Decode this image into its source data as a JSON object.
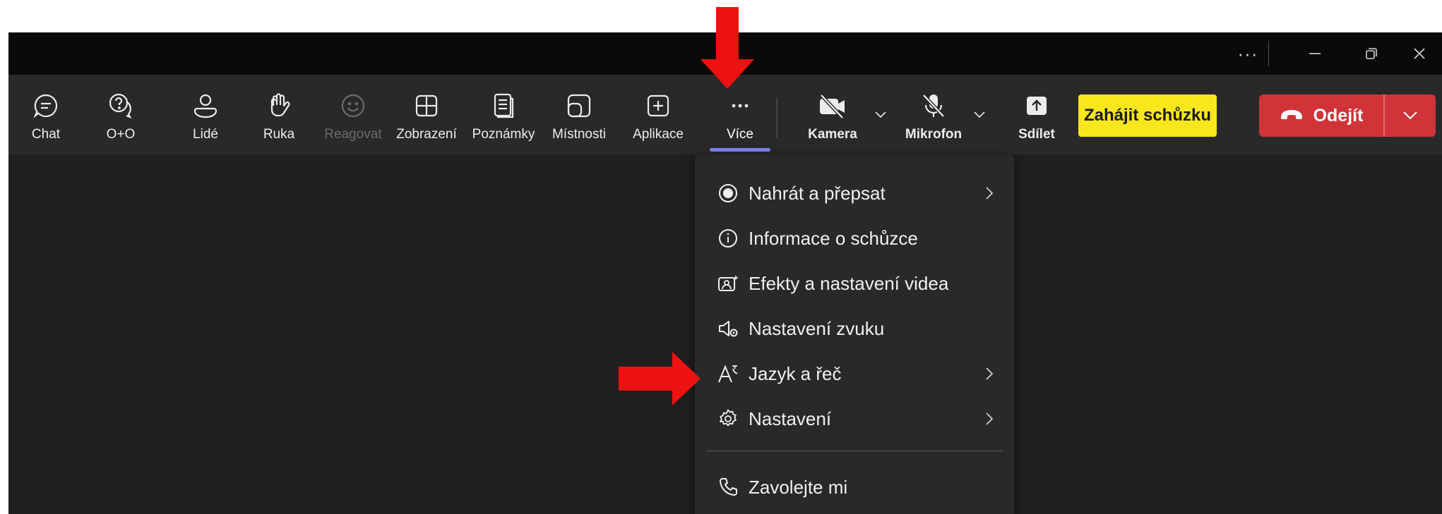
{
  "titlebar": {
    "more_icon": "more-horizontal-icon",
    "minimize_icon": "minimize-icon",
    "restore_icon": "restore-icon",
    "close_icon": "close-icon"
  },
  "toolbar": {
    "chat": "Chat",
    "qa": "O+O",
    "people": "Lidé",
    "raise_hand": "Ruka",
    "react": "Reagovat",
    "view": "Zobrazení",
    "notes": "Poznámky",
    "rooms": "Místnosti",
    "apps": "Aplikace",
    "more": "Více",
    "camera": "Kamera",
    "microphone": "Mikrofon",
    "share": "Sdílet",
    "start_meeting": "Zahájit schůzku",
    "leave": "Odejít"
  },
  "menu": {
    "items": [
      {
        "label": "Nahrát a přepsat",
        "icon": "record-icon",
        "submenu": true
      },
      {
        "label": "Informace o schůzce",
        "icon": "info-icon",
        "submenu": false
      },
      {
        "label": "Efekty a nastavení videa",
        "icon": "video-effects-icon",
        "submenu": false
      },
      {
        "label": "Nastavení zvuku",
        "icon": "speaker-settings-icon",
        "submenu": false
      },
      {
        "label": "Jazyk a řeč",
        "icon": "language-icon",
        "submenu": true
      },
      {
        "label": "Nastavení",
        "icon": "gear-icon",
        "submenu": true
      },
      {
        "label": "Zavolejte mi",
        "icon": "phone-icon",
        "submenu": false
      }
    ]
  },
  "colors": {
    "accent": "#7f85f5",
    "start_button": "#f8e71c",
    "leave_button": "#d13438",
    "annotation_arrow": "#ee1111"
  }
}
